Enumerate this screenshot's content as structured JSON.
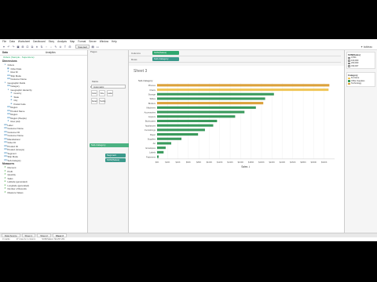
{
  "menubar": [
    "File",
    "Data",
    "Worksheet",
    "Dashboard",
    "Story",
    "Analysis",
    "Map",
    "Format",
    "Server",
    "Window",
    "Help"
  ],
  "toolbar": {
    "show_me_select": "Standard",
    "logo": "✦ tableau"
  },
  "datapane": {
    "tab_data": "Data",
    "tab_analytics": "Analytics",
    "source": "Orders (Sample - Superstore)",
    "dimensions_header": "Dimensions",
    "dimensions": [
      {
        "label": "Orders",
        "level": 1,
        "icon": "▾"
      },
      {
        "label": "Order Date",
        "level": 2,
        "icon": "▦"
      },
      {
        "label": "Row ID",
        "level": 2,
        "icon": "#"
      },
      {
        "label": "Ship Mode",
        "level": 2,
        "icon": "Abc"
      },
      {
        "label": "Customer Name",
        "level": 2,
        "icon": "Abc"
      },
      {
        "label": "Geographic Fields",
        "level": 1,
        "icon": "▾"
      },
      {
        "label": "Category",
        "level": 2,
        "icon": "Abc"
      },
      {
        "label": "Geographic Hierarchy",
        "level": 2,
        "icon": "▾"
      },
      {
        "label": "Country",
        "level": 3,
        "icon": "⊕"
      },
      {
        "label": "State",
        "level": 3,
        "icon": "⊕"
      },
      {
        "label": "City",
        "level": 3,
        "icon": "⊕"
      },
      {
        "label": "Postal Code",
        "level": 3,
        "icon": "⊕"
      },
      {
        "label": "Region",
        "level": 2,
        "icon": "Abc"
      },
      {
        "label": "Product Name",
        "level": 2,
        "icon": "Abc"
      },
      {
        "label": "Region",
        "level": 2,
        "icon": "Abc"
      },
      {
        "label": "Region (People)",
        "level": 2,
        "icon": "Abc"
      },
      {
        "label": "Row (old)",
        "level": 2,
        "icon": "#"
      },
      {
        "label": "Label",
        "level": 1,
        "icon": "Abc"
      },
      {
        "label": "Customer Name",
        "level": 1,
        "icon": "Abc"
      },
      {
        "label": "Customer ID",
        "level": 1,
        "icon": "Abc"
      },
      {
        "label": "Customer Name",
        "level": 1,
        "icon": "Abc"
      },
      {
        "label": "Manufacturer",
        "level": 1,
        "icon": "Abc"
      },
      {
        "label": "Order ID",
        "level": 1,
        "icon": "Abc"
      },
      {
        "label": "Product ID",
        "level": 1,
        "icon": "Abc"
      },
      {
        "label": "Product (Groups)",
        "level": 1,
        "icon": "Abc"
      },
      {
        "label": "Segment",
        "level": 1,
        "icon": "Abc"
      },
      {
        "label": "Ship Mode",
        "level": 1,
        "icon": "Abc"
      },
      {
        "label": "Sub-Category",
        "level": 1,
        "icon": "Abc"
      }
    ],
    "measures_header": "Measures",
    "measures": [
      {
        "label": "Discount",
        "icon": "#"
      },
      {
        "label": "Profit",
        "icon": "#"
      },
      {
        "label": "Quantity",
        "icon": "#"
      },
      {
        "label": "Sales",
        "icon": "#"
      },
      {
        "label": "Latitude (generated)",
        "icon": "⊕"
      },
      {
        "label": "Longitude (generated)",
        "icon": "⊕"
      },
      {
        "label": "Number of Records",
        "icon": "#"
      },
      {
        "label": "Measure Values",
        "icon": "#"
      }
    ]
  },
  "sidecol": {
    "pages": "Pages",
    "filters": "Filters",
    "marks": "Marks",
    "marks_type": "Automatic",
    "marks_buttons": [
      "Color",
      "Size",
      "Label",
      "Detail",
      "Tooltip"
    ],
    "drag_pill": "Sub-Category",
    "pill1": "Segment",
    "pill2": "SUM(Sales)"
  },
  "shelves": {
    "columns_label": "Columns",
    "columns_pill": "SUM(Sales)",
    "rows_label": "Rows",
    "rows_pill": "Sub-Category"
  },
  "canvas": {
    "sheet_title": "Sheet 3"
  },
  "chart_data": {
    "type": "bar",
    "orientation": "horizontal",
    "title": "",
    "xlabel": "Sales",
    "ylabel": "Sub-Category",
    "xlim": [
      0,
      340000
    ],
    "xticks": [
      "$0K",
      "$20K",
      "$40K",
      "$60K",
      "$80K",
      "$100K",
      "$120K",
      "$140K",
      "$160K",
      "$180K",
      "$200K",
      "$220K",
      "$240K",
      "$260K",
      "$280K",
      "$300K",
      "$320K"
    ],
    "categories": [
      "Phones",
      "Chairs",
      "Storage",
      "Tables",
      "Binders",
      "Machines",
      "Accessories",
      "Copiers",
      "Bookcases",
      "Appliances",
      "Furnishings",
      "Paper",
      "Supplies",
      "Art",
      "Envelopes",
      "Labels",
      "Fasteners"
    ],
    "values": [
      330007,
      328449,
      223844,
      206966,
      203413,
      189239,
      167380,
      149528,
      114880,
      107532,
      91705,
      78479,
      46674,
      27119,
      16476,
      12486,
      3024
    ],
    "bar_colors": [
      "#dba13a",
      "#f0c75a",
      "#3a9a5c",
      "#3a9a5c",
      "#dba13a",
      "#3a9a5c",
      "#3a9a5c",
      "#3a9a5c",
      "#3a9a5c",
      "#3a9a5c",
      "#3a9a5c",
      "#3a9a5c",
      "#3a9a5c",
      "#3a9a5c",
      "#3a9a5c",
      "#3a9a5c",
      "#3a9a5c"
    ],
    "header_label": "Sub-Category"
  },
  "legends": {
    "size_title": "SUM(Sales)",
    "size_items": [
      "3,024",
      "100,000",
      "200,000",
      "330,007"
    ],
    "color_title": "Category",
    "color_items": [
      {
        "label": "Furniture",
        "color": "#f0c75a"
      },
      {
        "label": "Office Supplies",
        "color": "#3a9a5c"
      },
      {
        "label": "Technology",
        "color": "#dba13a"
      }
    ]
  },
  "sheettabs": [
    "Data Source",
    "Sheet 1",
    "Sheet 2",
    "Sheet 3"
  ],
  "status": [
    "3 marks",
    "17 rows by 1 column",
    "SUM(Sales): $2,297,201"
  ]
}
